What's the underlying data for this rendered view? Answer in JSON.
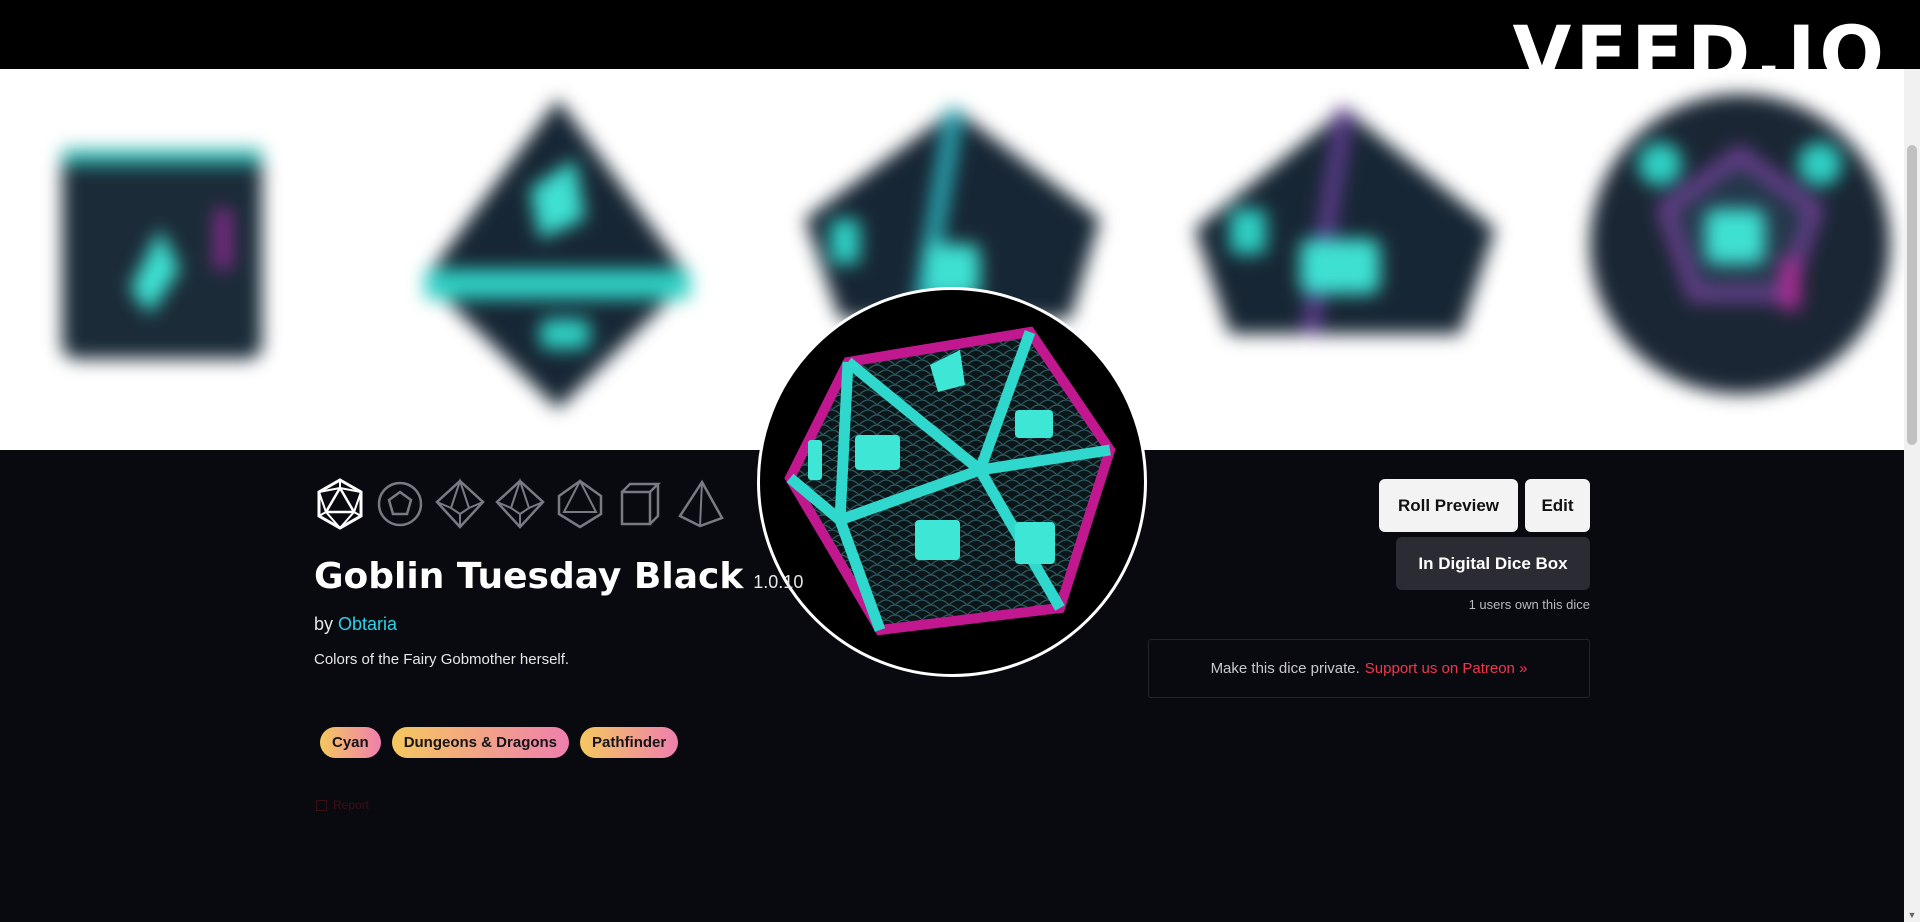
{
  "watermark": "VEED.IO",
  "dice": {
    "title": "Goblin Tuesday Black",
    "version": "1.0.10",
    "by_label": "by",
    "author": "Obtaria",
    "description": "Colors of the Fairy Gobmother herself.",
    "tags": [
      "Cyan",
      "Dungeons & Dragons",
      "Pathfinder"
    ],
    "report_label": "Report"
  },
  "dice_types": [
    "d20-icon",
    "d12-icon",
    "d10-icon",
    "d%-icon",
    "d8-icon",
    "d6-icon",
    "d4-icon"
  ],
  "actions": {
    "roll_preview": "Roll Preview",
    "edit": "Edit",
    "digital_dice_box": "In Digital Dice Box",
    "owners": "1 users own this dice"
  },
  "private_notice": {
    "text": "Make this dice private.",
    "link": "Support us on Patreon »"
  },
  "colors": {
    "background": "#090a10",
    "accent_cyan": "#2ed2e8",
    "accent_magenta": "#c2188f",
    "link_red": "#f2364f"
  }
}
